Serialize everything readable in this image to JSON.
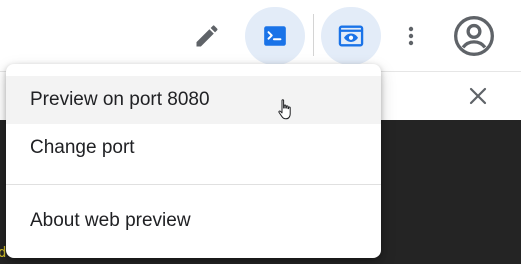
{
  "toolbar": {
    "icons": [
      "pencil-icon",
      "terminal-icon",
      "web-preview-icon",
      "more-vert-icon",
      "account-circle-icon"
    ],
    "accent": "#1a73e8",
    "active_bg": "#e3ecf8"
  },
  "panel": {
    "close_icon": "close-icon"
  },
  "terminal": {
    "fragment": "d"
  },
  "menu": {
    "items": [
      {
        "label": "Preview on port 8080"
      },
      {
        "label": "Change port"
      },
      {
        "label": "About web preview"
      }
    ],
    "hovered_index": 0
  }
}
